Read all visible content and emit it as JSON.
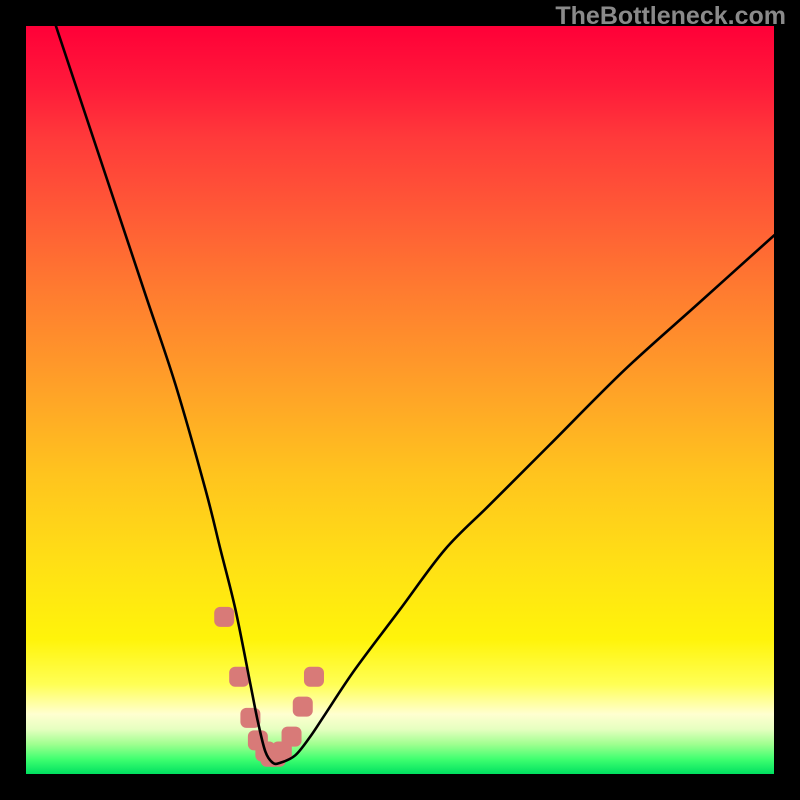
{
  "watermark": "TheBottleneck.com",
  "chart_data": {
    "type": "line",
    "title": "",
    "xlabel": "",
    "ylabel": "",
    "xlim": [
      0,
      100
    ],
    "ylim": [
      0,
      100
    ],
    "series": [
      {
        "name": "bottleneck-curve",
        "x": [
          4,
          8,
          12,
          16,
          20,
          24,
          26,
          28,
          30,
          31,
          32,
          33,
          34,
          36,
          38,
          40,
          44,
          50,
          56,
          62,
          70,
          80,
          90,
          100
        ],
        "values": [
          100,
          88,
          76,
          64,
          52,
          38,
          30,
          22,
          12,
          7,
          3,
          1.5,
          1.5,
          2.5,
          5,
          8,
          14,
          22,
          30,
          36,
          44,
          54,
          63,
          72
        ]
      },
      {
        "name": "low-band-markers",
        "x": [
          26.5,
          28.5,
          30,
          31,
          32,
          32.7,
          33.4,
          34.2,
          35.5,
          37,
          38.5
        ],
        "values": [
          21,
          13,
          7.5,
          4.5,
          3,
          2.3,
          2.3,
          3,
          5,
          9,
          13
        ]
      }
    ],
    "colors": {
      "curve": "#000000",
      "markers": "#d87a78"
    }
  }
}
